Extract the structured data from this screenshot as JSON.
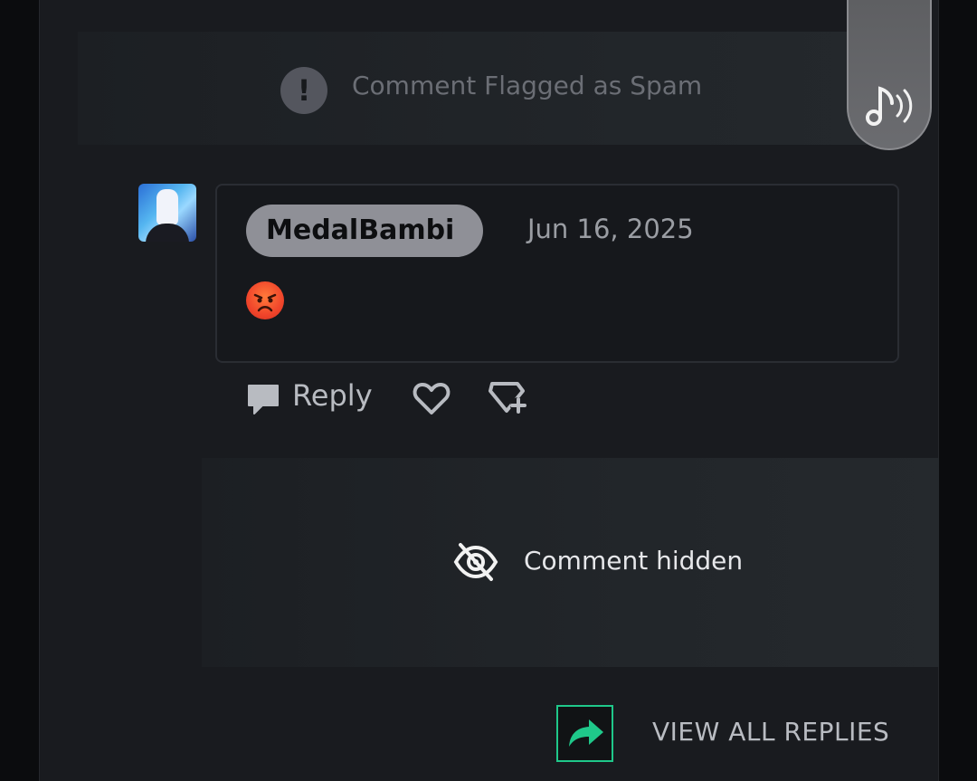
{
  "spam_notice": {
    "icon": "exclamation-icon",
    "glyph": "!",
    "text": "Comment Flagged as Spam"
  },
  "audio_button": {
    "icon": "music-audio-icon"
  },
  "comment": {
    "username": "MedalBambi",
    "date": "Jun 16, 2025",
    "emoji": "angry-face-emoji"
  },
  "actions": {
    "reply_label": "Reply",
    "like_icon": "heart-icon",
    "gift_icon": "gift-plus-icon"
  },
  "hidden_reply": {
    "icon": "eye-slash-icon",
    "text": "Comment hidden"
  },
  "view_replies": {
    "label": "VIEW ALL REPLIES",
    "icon": "share-arrow-icon",
    "accent": "#1fc88a"
  }
}
